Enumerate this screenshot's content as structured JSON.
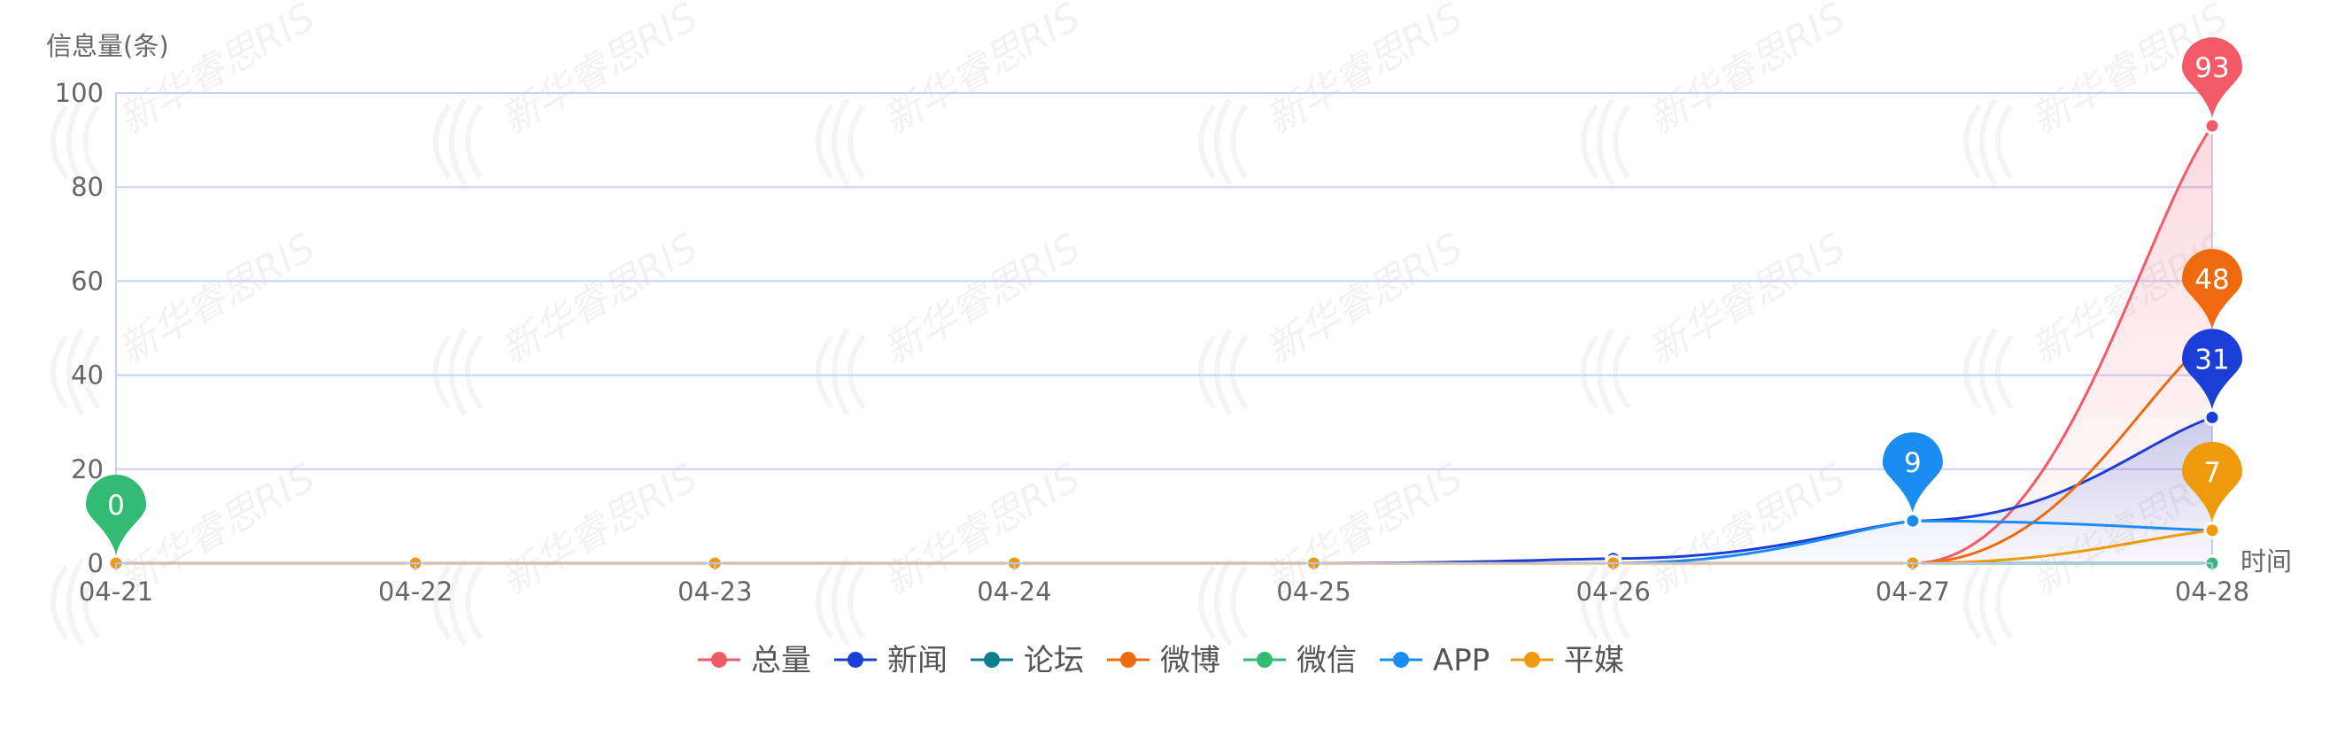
{
  "chart_data": {
    "type": "line",
    "title": "",
    "ylabel": "信息量(条)",
    "xlabel": "时间",
    "x": [
      "04-21",
      "04-22",
      "04-23",
      "04-24",
      "04-25",
      "04-26",
      "04-27",
      "04-28"
    ],
    "yticks": [
      "0",
      "20",
      "40",
      "60",
      "80",
      "100"
    ],
    "ylim": [
      0,
      100
    ],
    "grid": true,
    "legend_position": "bottom-center",
    "watermark": "新华睿思RIS",
    "series": [
      {
        "name": "总量",
        "color": "#f25a68",
        "values": [
          0,
          0,
          0,
          0,
          0,
          0,
          0,
          93
        ],
        "area": true
      },
      {
        "name": "新闻",
        "color": "#1b3fd6",
        "values": [
          0,
          0,
          0,
          0,
          0,
          1,
          9,
          31
        ],
        "area": true
      },
      {
        "name": "论坛",
        "color": "#0a7e8c",
        "values": [
          0,
          0,
          0,
          0,
          0,
          0,
          0,
          0
        ]
      },
      {
        "name": "微博",
        "color": "#ef6a0f",
        "values": [
          0,
          0,
          0,
          0,
          0,
          0,
          0,
          48
        ]
      },
      {
        "name": "微信",
        "color": "#33bb73",
        "values": [
          0,
          0,
          0,
          0,
          0,
          0,
          0,
          0
        ]
      },
      {
        "name": "APP",
        "color": "#1b8cf2",
        "values": [
          0,
          0,
          0,
          0,
          0,
          0,
          9,
          7
        ]
      },
      {
        "name": "平媒",
        "color": "#ee9a0c",
        "values": [
          0,
          0,
          0,
          0,
          0,
          0,
          0,
          7
        ]
      }
    ],
    "markers": [
      {
        "series": "微信",
        "index": 0,
        "label": "0"
      },
      {
        "series": "APP",
        "index": 6,
        "label": "9"
      },
      {
        "series": "总量",
        "index": 7,
        "label": "93"
      },
      {
        "series": "微博",
        "index": 7,
        "label": "48"
      },
      {
        "series": "新闻",
        "index": 7,
        "label": "31"
      },
      {
        "series": "平媒",
        "index": 7,
        "label": "7"
      }
    ]
  }
}
